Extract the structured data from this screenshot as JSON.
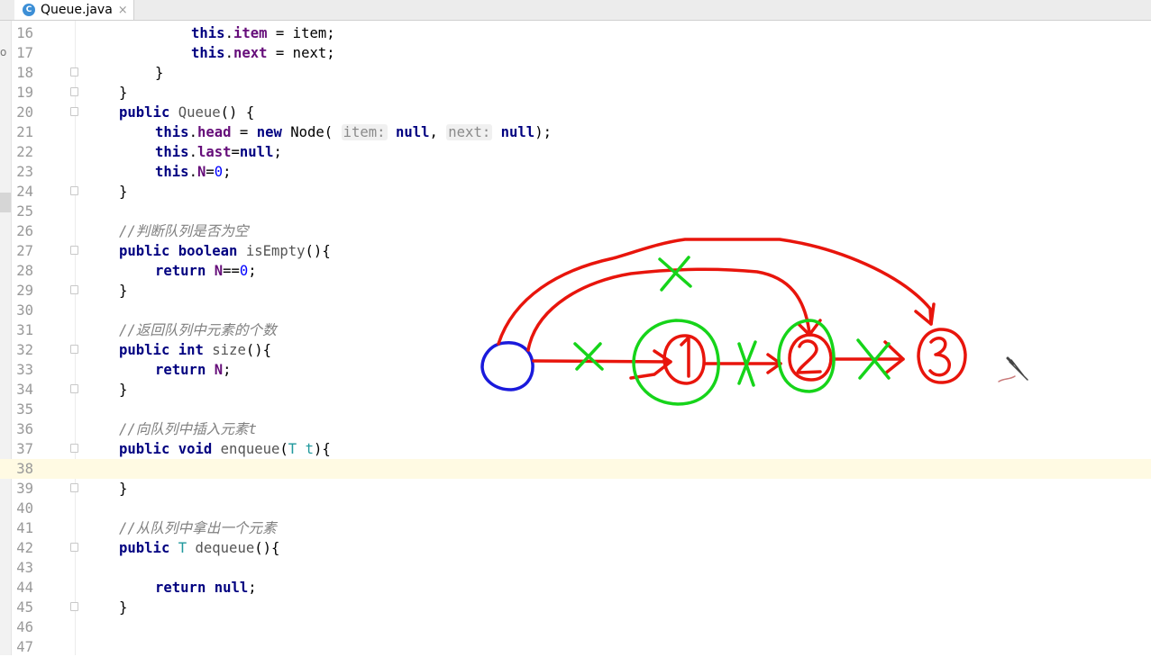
{
  "tab": {
    "icon_letter": "C",
    "filename": "Queue.java",
    "close_glyph": "×"
  },
  "left_strip_text": "o",
  "code_lines": [
    {
      "num": "16",
      "indent": 2,
      "tokens": [
        [
          "kw",
          "this"
        ],
        [
          "p",
          "."
        ],
        [
          "fld",
          "item"
        ],
        [
          "p",
          " = item;"
        ]
      ]
    },
    {
      "num": "17",
      "indent": 2,
      "tokens": [
        [
          "kw",
          "this"
        ],
        [
          "p",
          "."
        ],
        [
          "fld",
          "next"
        ],
        [
          "p",
          " = next;"
        ]
      ]
    },
    {
      "num": "18",
      "indent": 1,
      "fold": true,
      "tokens": [
        [
          "p",
          "}"
        ]
      ]
    },
    {
      "num": "19",
      "indent": 0,
      "fold": true,
      "tokens": [
        [
          "p",
          "}"
        ]
      ]
    },
    {
      "num": "20",
      "indent": 0,
      "fold": true,
      "tokens": [
        [
          "kw",
          "public "
        ],
        [
          "fn",
          "Queue"
        ],
        [
          "p",
          "() {"
        ]
      ]
    },
    {
      "num": "21",
      "indent": 1,
      "tokens": [
        [
          "kw",
          "this"
        ],
        [
          "p",
          "."
        ],
        [
          "fld",
          "head"
        ],
        [
          "p",
          " = "
        ],
        [
          "kw",
          "new "
        ],
        [
          "p",
          "Node( "
        ],
        [
          "hint",
          "item:"
        ],
        [
          "p",
          " "
        ],
        [
          "kw",
          "null"
        ],
        [
          "p",
          ", "
        ],
        [
          "hint",
          "next:"
        ],
        [
          "p",
          " "
        ],
        [
          "kw",
          "null"
        ],
        [
          "p",
          ");"
        ]
      ]
    },
    {
      "num": "22",
      "indent": 1,
      "tokens": [
        [
          "kw",
          "this"
        ],
        [
          "p",
          "."
        ],
        [
          "fld",
          "last"
        ],
        [
          "p",
          "="
        ],
        [
          "kw",
          "null"
        ],
        [
          "p",
          ";"
        ]
      ]
    },
    {
      "num": "23",
      "indent": 1,
      "tokens": [
        [
          "kw",
          "this"
        ],
        [
          "p",
          "."
        ],
        [
          "fld",
          "N"
        ],
        [
          "p",
          "="
        ],
        [
          "num",
          "0"
        ],
        [
          "p",
          ";"
        ]
      ]
    },
    {
      "num": "24",
      "indent": 0,
      "fold": true,
      "tokens": [
        [
          "p",
          "}"
        ]
      ]
    },
    {
      "num": "25",
      "indent": 0,
      "tokens": []
    },
    {
      "num": "26",
      "indent": 0,
      "tokens": [
        [
          "cmt",
          "//判断队列是否为空"
        ]
      ]
    },
    {
      "num": "27",
      "indent": 0,
      "fold": true,
      "tokens": [
        [
          "kw",
          "public boolean "
        ],
        [
          "fn",
          "isEmpty"
        ],
        [
          "p",
          "(){"
        ]
      ]
    },
    {
      "num": "28",
      "indent": 1,
      "tokens": [
        [
          "kw",
          "return "
        ],
        [
          "fld",
          "N"
        ],
        [
          "p",
          "=="
        ],
        [
          "num",
          "0"
        ],
        [
          "p",
          ";"
        ]
      ]
    },
    {
      "num": "29",
      "indent": 0,
      "fold": true,
      "tokens": [
        [
          "p",
          "}"
        ]
      ]
    },
    {
      "num": "30",
      "indent": 0,
      "tokens": []
    },
    {
      "num": "31",
      "indent": 0,
      "tokens": [
        [
          "cmt",
          "//返回队列中元素的个数"
        ]
      ]
    },
    {
      "num": "32",
      "indent": 0,
      "fold": true,
      "tokens": [
        [
          "kw",
          "public int "
        ],
        [
          "fn",
          "size"
        ],
        [
          "p",
          "(){"
        ]
      ]
    },
    {
      "num": "33",
      "indent": 1,
      "tokens": [
        [
          "kw",
          "return "
        ],
        [
          "fld",
          "N"
        ],
        [
          "p",
          ";"
        ]
      ]
    },
    {
      "num": "34",
      "indent": 0,
      "fold": true,
      "tokens": [
        [
          "p",
          "}"
        ]
      ]
    },
    {
      "num": "35",
      "indent": 0,
      "tokens": []
    },
    {
      "num": "36",
      "indent": 0,
      "tokens": [
        [
          "cmt",
          "//向队列中插入元素t"
        ]
      ]
    },
    {
      "num": "37",
      "indent": 0,
      "fold": true,
      "tokens": [
        [
          "kw",
          "public void "
        ],
        [
          "fn",
          "enqueue"
        ],
        [
          "p",
          "("
        ],
        [
          "tp",
          "T"
        ],
        [
          "p",
          " "
        ],
        [
          "tp",
          "t"
        ],
        [
          "p",
          "){"
        ]
      ]
    },
    {
      "num": "38",
      "indent": 0,
      "current": true,
      "tokens": []
    },
    {
      "num": "39",
      "indent": 0,
      "fold": true,
      "tokens": [
        [
          "p",
          "}"
        ]
      ]
    },
    {
      "num": "40",
      "indent": 0,
      "tokens": []
    },
    {
      "num": "41",
      "indent": 0,
      "tokens": [
        [
          "cmt",
          "//从队列中拿出一个元素"
        ]
      ]
    },
    {
      "num": "42",
      "indent": 0,
      "fold": true,
      "tokens": [
        [
          "kw",
          "public "
        ],
        [
          "tp",
          "T "
        ],
        [
          "fn",
          "dequeue"
        ],
        [
          "p",
          "(){"
        ]
      ]
    },
    {
      "num": "43",
      "indent": 0,
      "tokens": []
    },
    {
      "num": "44",
      "indent": 1,
      "tokens": [
        [
          "kw",
          "return null"
        ],
        [
          "p",
          ";"
        ]
      ]
    },
    {
      "num": "45",
      "indent": 0,
      "fold": true,
      "tokens": [
        [
          "p",
          "}"
        ]
      ]
    },
    {
      "num": "46",
      "indent": 0,
      "tokens": []
    },
    {
      "num": "47",
      "indent": 0,
      "tokens": []
    }
  ],
  "annotation": {
    "colors": {
      "node_head": "#1a1adc",
      "nodes": "#e8150c",
      "crossed": "#16d41a"
    },
    "node_labels": [
      "1",
      "2",
      "3"
    ]
  }
}
